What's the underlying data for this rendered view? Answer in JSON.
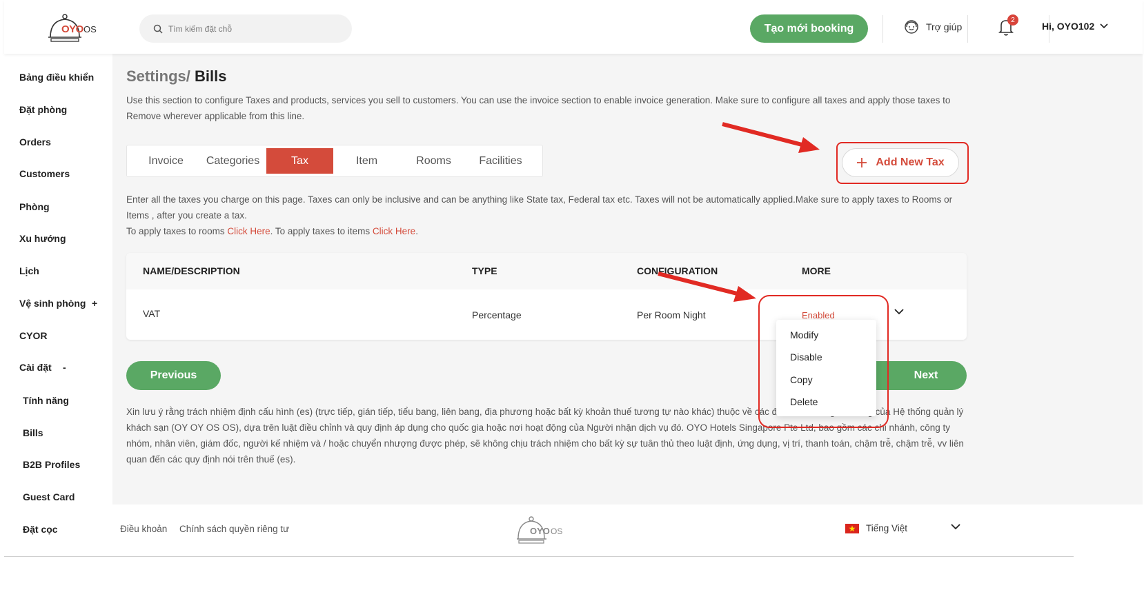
{
  "header": {
    "logo_text": "OYO",
    "logo_suffix": "OS",
    "search_placeholder": "Tìm kiếm đặt chỗ",
    "create_booking_label": "Tạo mới booking",
    "help_label": "Trợ giúp",
    "notification_count": "2",
    "user_greeting": "Hi, OYO102"
  },
  "sidebar": {
    "items": [
      {
        "label": "Bảng điều khiển"
      },
      {
        "label": "Đặt phòng"
      },
      {
        "label": "Orders"
      },
      {
        "label": "Customers"
      },
      {
        "label": "Phòng"
      },
      {
        "label": "Xu hướng"
      },
      {
        "label": "Lịch"
      },
      {
        "label": "Vệ sinh phòng",
        "toggle": "+"
      },
      {
        "label": "CYOR"
      },
      {
        "label": "Cài đặt",
        "toggle": "-"
      },
      {
        "label": "Tính năng"
      },
      {
        "label": "Bills"
      },
      {
        "label": "B2B Profiles"
      },
      {
        "label": "Guest Card"
      },
      {
        "label": "Đặt cọc"
      }
    ]
  },
  "main": {
    "breadcrumb_parent": "Settings",
    "breadcrumb_separator": "/",
    "breadcrumb_current": "Bills",
    "description": "Use this section to configure Taxes and products, services you sell to customers. You can use the invoice section to enable invoice generation. Make sure to configure all taxes and apply those taxes to Remove wherever applicable from this line.",
    "tabs": [
      {
        "label": "Invoice"
      },
      {
        "label": "Categories"
      },
      {
        "label": "Tax",
        "active": true
      },
      {
        "label": "Item"
      },
      {
        "label": "Rooms"
      },
      {
        "label": "Facilities"
      }
    ],
    "add_tax_label": "Add New Tax",
    "info_line1": "Enter all the taxes you charge on this page. Taxes can only be inclusive and can be anything like State tax, Federal tax etc. Taxes will not be automatically applied.Make sure to apply taxes to Rooms or Items , after you create a tax.",
    "info_apply_rooms": "To apply taxes to rooms ",
    "info_click_here_1": "Click Here",
    "info_apply_items": ". To apply taxes to items ",
    "info_click_here_2": "Click Here",
    "info_end": ".",
    "table": {
      "headers": [
        "NAME/DESCRIPTION",
        "TYPE",
        "CONFIGURATION",
        "MORE"
      ],
      "rows": [
        {
          "name": "VAT",
          "type": "Percentage",
          "configuration": "Per Room Night",
          "status": "Enabled"
        }
      ]
    },
    "dropdown_items": [
      "Modify",
      "Disable",
      "Copy",
      "Delete"
    ],
    "previous_label": "Previous",
    "next_label": "Next",
    "disclaimer": "Xin lưu ý rằng trách nhiệm định cấu hình (es) (trực tiếp, gián tiếp, tiểu bang, liên bang, địa phương hoặc bất kỳ khoản thuế tương tự nào khác) thuộc về các đối tác hoặc người dùng của Hệ thống quản lý khách sạn (OY OY OS OS), dựa trên luật điều chỉnh và quy định áp dụng cho quốc gia hoặc nơi hoạt động của Người nhận dịch vụ đó. OYO Hotels Singapore Pte Ltd, bao gồm các chi nhánh, công ty nhóm, nhân viên, giám đốc, người kế nhiệm và / hoặc chuyển nhượng được phép, sẽ không chịu trách nhiệm cho bất kỳ sự tuân thủ theo luật định, ứng dụng, vị trí, thanh toán, chậm trễ, chậm trễ, vv liên quan đến các quy định nói trên thuế (es)."
  },
  "footer": {
    "terms_label": "Điều khoản",
    "privacy_label": "Chính sách quyền riêng tư",
    "language_label": "Tiếng Việt"
  },
  "colors": {
    "brand_red": "#d44b3b",
    "accent_green": "#5aa864",
    "annotation_red": "#e12a23"
  }
}
